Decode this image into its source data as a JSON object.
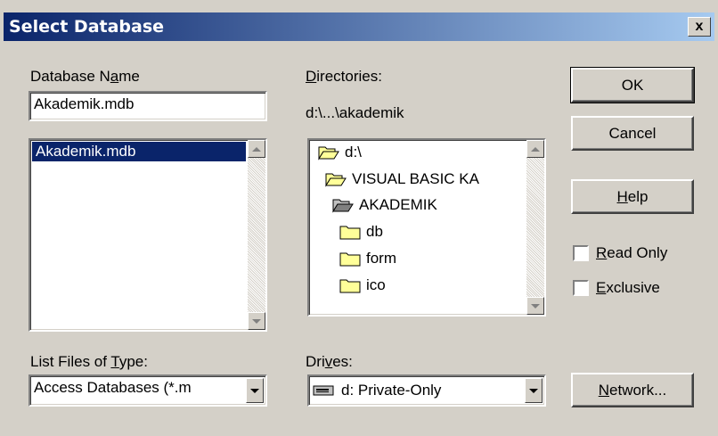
{
  "window": {
    "title": "Select Database",
    "close_label": "x"
  },
  "database_name": {
    "label_before": "Database N",
    "label_accel": "a",
    "label_after": "me",
    "value": "Akademik.mdb",
    "files": [
      "Akademik.mdb"
    ]
  },
  "directories": {
    "label_accel": "D",
    "label_after": "irectories:",
    "current_path": "d:\\...\\akademik",
    "tree": [
      "d:\\",
      "VISUAL BASIC KA",
      "AKADEMIK",
      "db",
      "form",
      "ico"
    ]
  },
  "file_type": {
    "label_before": "List Files of ",
    "label_accel": "T",
    "label_after": "ype:",
    "value": "Access Databases (*.m"
  },
  "drives": {
    "label_before": "Dri",
    "label_accel": "v",
    "label_after": "es:",
    "value": "d: Private-Only"
  },
  "buttons": {
    "ok": "OK",
    "cancel": "Cancel",
    "help_accel": "H",
    "help_after": "elp",
    "network_accel": "N",
    "network_after": "etwork..."
  },
  "options": {
    "read_only_accel": "R",
    "read_only_after": "ead Only",
    "read_only_checked": false,
    "exclusive_accel": "E",
    "exclusive_after": "xclusive",
    "exclusive_checked": false
  },
  "colors": {
    "titlebar_start": "#0a246a",
    "titlebar_end": "#a6caf0",
    "selection": "#0a246a",
    "folder": "#ffff99"
  }
}
